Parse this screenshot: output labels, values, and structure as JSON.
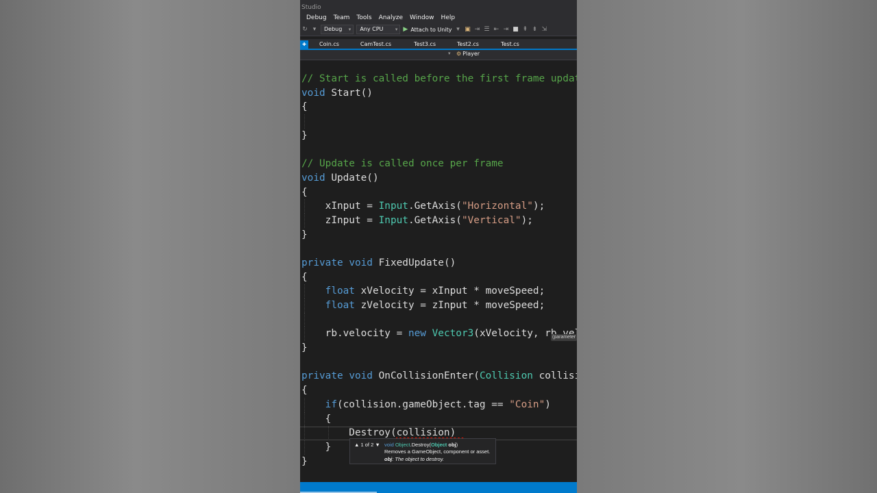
{
  "window": {
    "title": "Studio"
  },
  "menu": [
    "Debug",
    "Team",
    "Tools",
    "Analyze",
    "Window",
    "Help"
  ],
  "toolbar": {
    "config": "Debug",
    "platform": "Any CPU",
    "attach": "Attach to Unity"
  },
  "tabs": [
    "Coin.cs",
    "CamTest.cs",
    "Test3.cs",
    "Test2.cs",
    "Test.cs"
  ],
  "navbar": {
    "member": "Player"
  },
  "code": {
    "l1": "// Start is called before the first frame update",
    "l2_kw": "void",
    "l2_rest": " Start()",
    "brace_open": "{",
    "brace_close": "}",
    "l6": "// Update is called once per frame",
    "l7_kw": "void",
    "l7_rest": " Update()",
    "l9_a": "    xInput = ",
    "l9_ty": "Input",
    "l9_b": ".GetAxis(",
    "l9_st": "\"Horizontal\"",
    "l9_c": ");",
    "l10_a": "    zInput = ",
    "l10_ty": "Input",
    "l10_b": ".GetAxis(",
    "l10_st": "\"Vertical\"",
    "l10_c": ");",
    "l13_kw1": "private",
    "l13_kw2": " void",
    "l13_rest": " FixedUpdate()",
    "l15_kw": "    float",
    "l15_rest": " xVelocity = xInput * moveSpeed;",
    "l16_kw": "    float",
    "l16_rest": " zVelocity = zInput * moveSpeed;",
    "l18_a": "    rb.velocity = ",
    "l18_kw": "new",
    "l18_sp": " ",
    "l18_ty": "Vector3",
    "l18_b": "(xVelocity, rb.velocity.y, zVelocity);",
    "l21_kw1": "private",
    "l21_kw2": " void",
    "l21_rest": " OnCollisionEnter(",
    "l21_ty": "Collision",
    "l21_b": " collision)",
    "l23_a": "    ",
    "l23_kw": "if",
    "l23_b": "(collision.gameObject.tag == ",
    "l23_st": "\"Coin\"",
    "l23_c": ")",
    "l24": "    {",
    "l25": "        Destroy(collision)",
    "l26": "    }"
  },
  "tooltip": {
    "nav": "▲ 1 of 2 ▼",
    "sig_kw": "void ",
    "sig_ty": "Object",
    "sig_mid": ".Destroy(",
    "sig_ty2": "Object",
    "sig_param": " obj",
    "sig_end": ")",
    "desc": "Removes a GameObject, component or asset.",
    "param_name": "obj",
    "param_desc": ": The object to destroy."
  },
  "hint": "(parameter"
}
